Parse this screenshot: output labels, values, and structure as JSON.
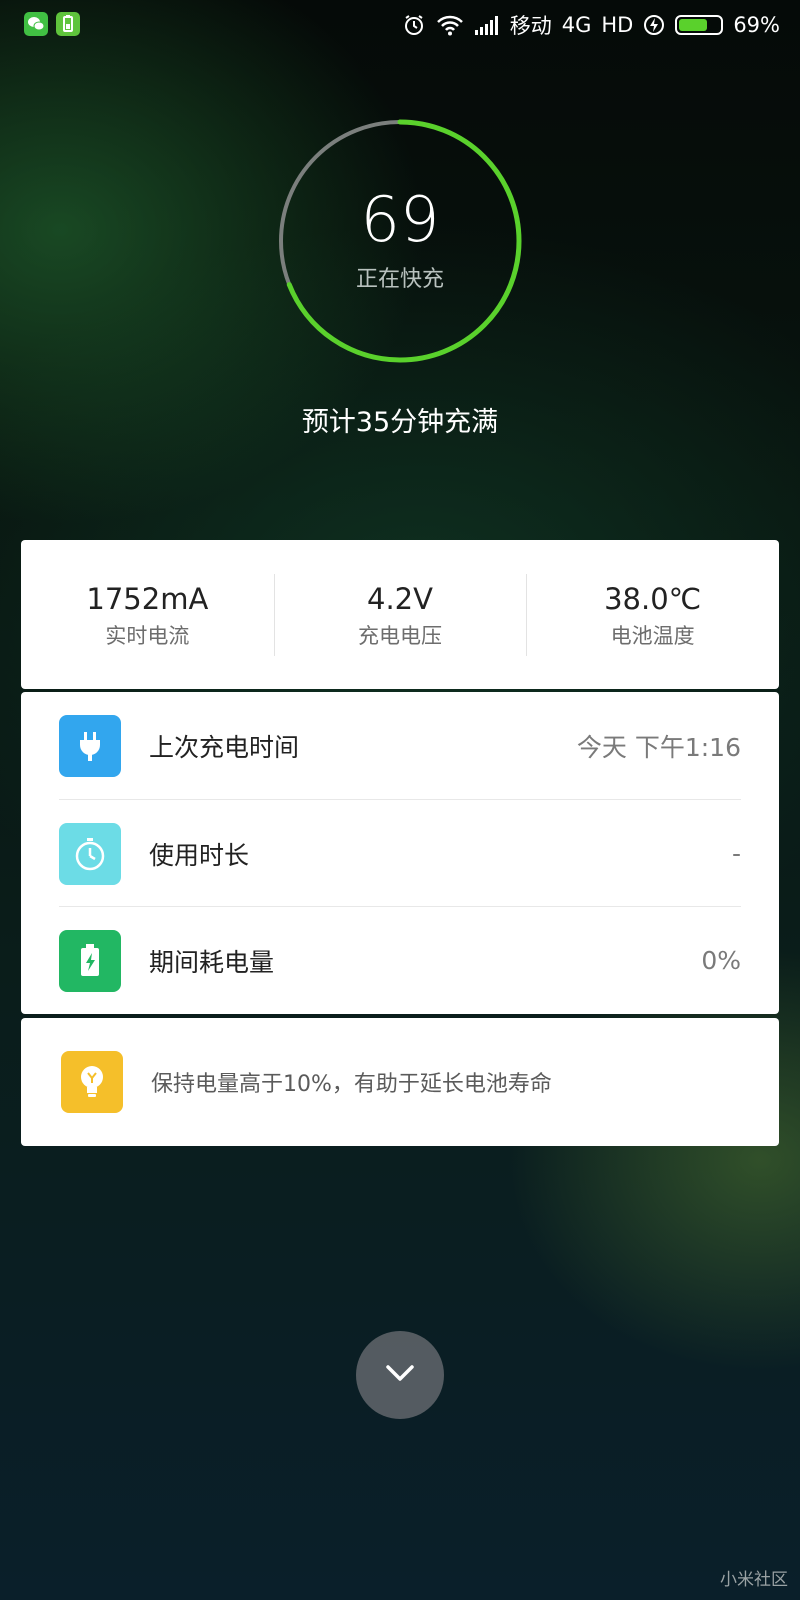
{
  "status_bar": {
    "carrier": "移动",
    "network": "4G",
    "hd": "HD",
    "battery_percent": "69%",
    "battery_level": 0.69
  },
  "charging": {
    "level": "69",
    "level_fraction": 0.69,
    "status": "正在快充",
    "estimate": "预计35分钟充满",
    "ring_color": "#5ad12c"
  },
  "stats": [
    {
      "value": "1752mA",
      "label": "实时电流"
    },
    {
      "value": "4.2V",
      "label": "充电电压"
    },
    {
      "value": "38.0℃",
      "label": "电池温度"
    }
  ],
  "info_rows": [
    {
      "label": "上次充电时间",
      "value": "今天 下午1:16",
      "icon": "plug-icon",
      "color": "#32a6ee"
    },
    {
      "label": "使用时长",
      "value": "-",
      "icon": "stopwatch-icon",
      "color": "#6cdce6"
    },
    {
      "label": "期间耗电量",
      "value": "0%",
      "icon": "battery-bolt-icon",
      "color": "#22b763"
    }
  ],
  "tip": {
    "text": "保持电量高于10%，有助于延长电池寿命",
    "icon": "lightbulb-icon",
    "color": "#f5bf2a"
  },
  "collapse_icon": "chevron-down-icon",
  "watermark": "小米社区"
}
